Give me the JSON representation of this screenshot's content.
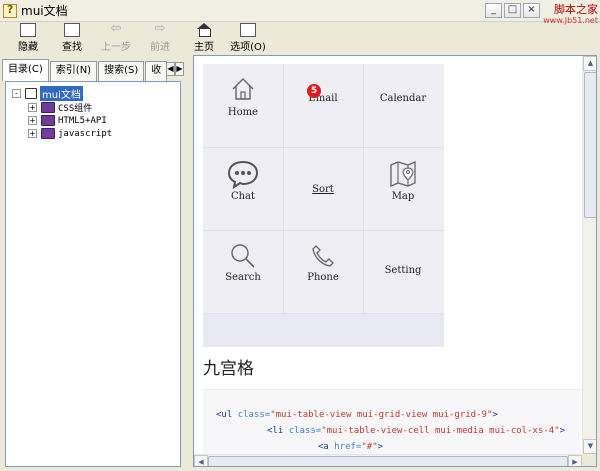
{
  "window": {
    "title": "mui文档",
    "watermark": "脚本之家",
    "watermark_url": "www.Jb51.net",
    "buttons": {
      "minimize": "_",
      "maximize": "□",
      "close": "×"
    }
  },
  "toolbar": {
    "hide_label": "隐藏",
    "find_label": "查找",
    "back_label": "上一步",
    "forward_label": "前进",
    "home_label": "主页",
    "options_label": "选项(O)"
  },
  "tabs": {
    "contents": "目录(C)",
    "index": "索引(N)",
    "search": "搜索(S)",
    "favorites": "收",
    "scroll_left": "◀",
    "scroll_right": "▶"
  },
  "tree": {
    "root": "mui文档",
    "items": [
      {
        "label": "CSS组件",
        "expander": "+"
      },
      {
        "label": "HTML5+API",
        "expander": "+"
      },
      {
        "label": "javascript",
        "expander": "+"
      }
    ],
    "root_expander": "-"
  },
  "grid": {
    "items": [
      {
        "label": "Home",
        "icon": "home-icon"
      },
      {
        "label": "Email",
        "icon": "email-icon",
        "badge": "5"
      },
      {
        "label": "Calendar",
        "icon": "calendar-icon"
      },
      {
        "label": "Chat",
        "icon": "chat-icon"
      },
      {
        "label": "Sort",
        "icon": "sort-icon"
      },
      {
        "label": "Map",
        "icon": "map-icon"
      },
      {
        "label": "Search",
        "icon": "search-icon"
      },
      {
        "label": "Phone",
        "icon": "phone-icon"
      },
      {
        "label": "Setting",
        "icon": "setting-icon"
      }
    ]
  },
  "section": {
    "heading": "九宫格"
  },
  "code": {
    "line1_tag": "<ul ",
    "line1_attr": "class=",
    "line1_val": "\"mui-table-view mui-grid-view mui-grid-9\"",
    "line1_end": ">",
    "line2_tag": "<li ",
    "line2_attr": "class=",
    "line2_val": "\"mui-table-view-cell mui-media mui-col-xs-4\"",
    "line2_end": ">",
    "line3_tag": "<a ",
    "line3_attr": "href=",
    "line3_val": "\"#\"",
    "line3_end": ">"
  },
  "scroll": {
    "up": "▲",
    "down": "▼",
    "left": "◀",
    "right": "▶"
  }
}
